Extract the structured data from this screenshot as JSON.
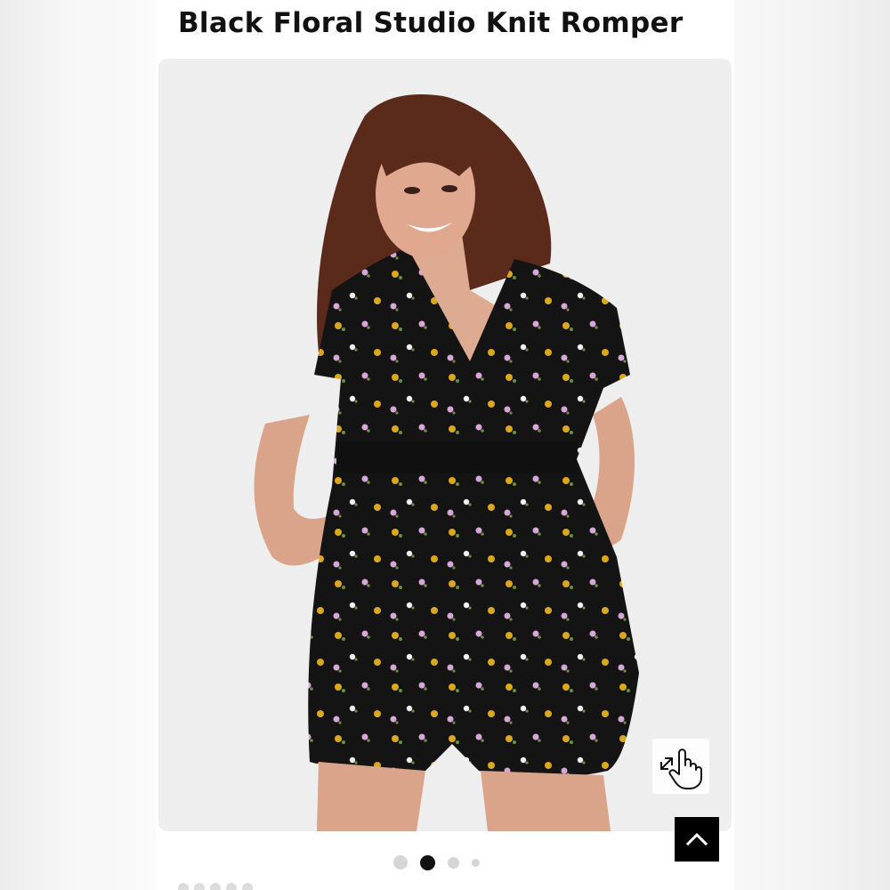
{
  "product": {
    "title": "Black Floral Studio Knit Romper"
  },
  "gallery": {
    "image_count": 4,
    "active_index": 2
  },
  "icons": {
    "zoom_hint": "tap-to-zoom-icon",
    "back_to_top": "chevron-up-icon"
  },
  "colors": {
    "romper": "#141414",
    "flower_yellow": "#d9a81e",
    "flower_pink": "#d9a6d8",
    "back_to_top_bg": "#000000",
    "active_dot": "#111111",
    "inactive_dot": "#d6d6d6"
  }
}
